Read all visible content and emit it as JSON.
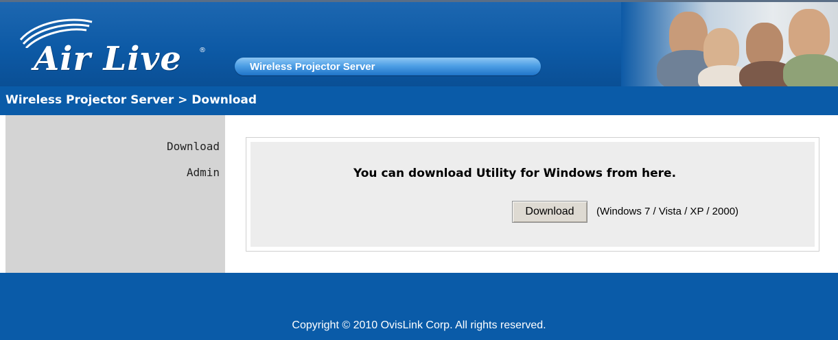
{
  "header": {
    "logo_text": "Air Live",
    "logo_reg": "®",
    "product_title": "Wireless Projector Server"
  },
  "breadcrumb": {
    "text": "Wireless Projector Server > Download"
  },
  "sidebar": {
    "items": [
      {
        "label": "Download"
      },
      {
        "label": "Admin"
      }
    ]
  },
  "main": {
    "message": "You can download Utility for Windows from here.",
    "download_label": "Download",
    "os_note": "(Windows 7 / Vista / XP / 2000)"
  },
  "footer": {
    "copyright": "Copyright © 2010 OvisLink Corp. All rights reserved."
  },
  "colors": {
    "primary_blue": "#0a5ba8",
    "sidebar_gray": "#d4d4d4",
    "content_gray": "#ededed"
  }
}
